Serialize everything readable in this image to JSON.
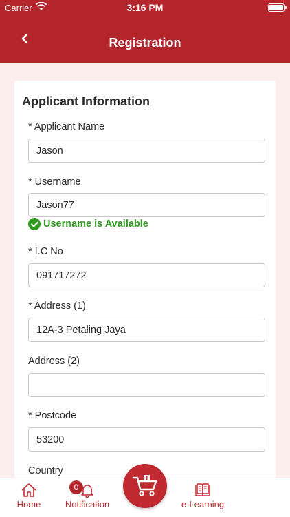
{
  "status_bar": {
    "carrier": "Carrier",
    "time": "3:16 PM"
  },
  "nav": {
    "title": "Registration"
  },
  "form": {
    "section_title": "Applicant Information",
    "applicant_name": {
      "label": "* Applicant Name",
      "value": "Jason"
    },
    "username": {
      "label": "* Username",
      "value": "Jason77",
      "status": "Username is Available"
    },
    "ic_no": {
      "label": "* I.C No",
      "value": "091717272"
    },
    "address1": {
      "label": "* Address (1)",
      "value": "12A-3 Petaling Jaya"
    },
    "address2": {
      "label": "Address (2)",
      "value": ""
    },
    "postcode": {
      "label": "* Postcode",
      "value": "53200"
    },
    "country": {
      "label": "Country"
    }
  },
  "tabs": {
    "home": "Home",
    "notification": "Notification",
    "notification_count": "0",
    "elearning": "e-Learning"
  },
  "colors": {
    "brand": "#b4262c",
    "success": "#2f9a1f",
    "background": "#fdeeee"
  },
  "icons": [
    "wifi-icon",
    "battery-icon",
    "back-chevron-icon",
    "check-circle-icon",
    "home-icon",
    "bell-icon",
    "cart-icon",
    "book-icon"
  ]
}
